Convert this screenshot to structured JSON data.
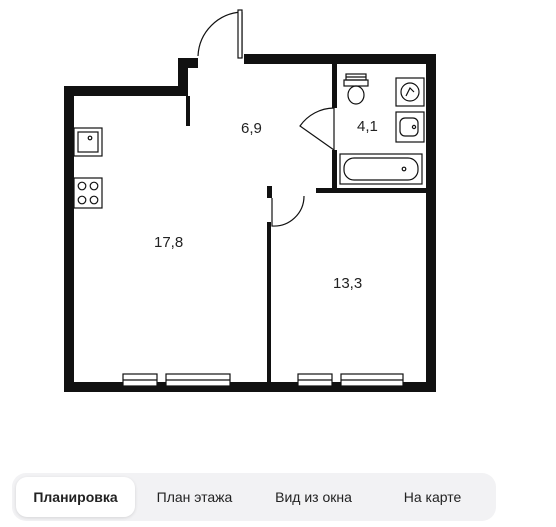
{
  "rooms": [
    {
      "id": "kitchen-living",
      "area": "17,8"
    },
    {
      "id": "hall",
      "area": "6,9"
    },
    {
      "id": "bathroom",
      "area": "4,1"
    },
    {
      "id": "bedroom",
      "area": "13,3"
    }
  ],
  "tabs": [
    {
      "label": "Планировка",
      "active": true
    },
    {
      "label": "План этажа",
      "active": false
    },
    {
      "label": "Вид из окна",
      "active": false
    },
    {
      "label": "На карте",
      "active": false
    }
  ],
  "colors": {
    "wall": "#111111",
    "tab_bg": "#f2f2f4",
    "tab_active": "#ffffff"
  }
}
